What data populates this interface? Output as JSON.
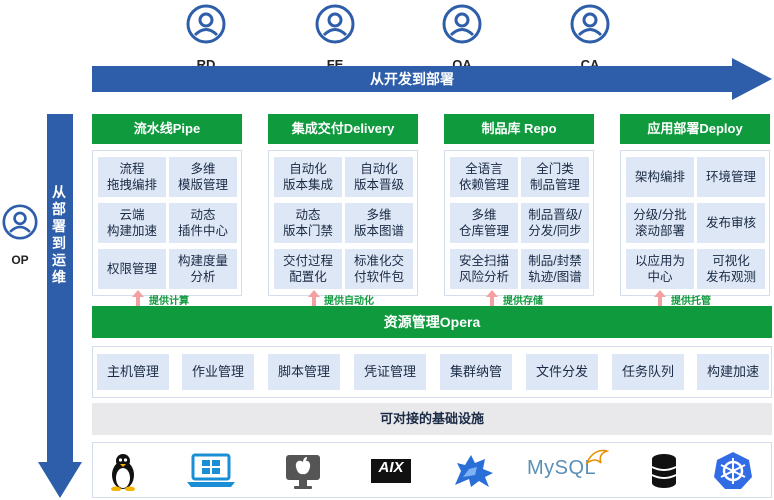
{
  "roles": [
    "RD",
    "FE",
    "QA",
    "CA"
  ],
  "op_role": "OP",
  "top_arrow_label": "从开发到部署",
  "side_arrow_label": [
    "从",
    "部",
    "署",
    "到",
    "运",
    "维"
  ],
  "panels": [
    {
      "title": "流水线Pipe",
      "items": [
        "流程\n拖拽编排",
        "多维\n模版管理",
        "云端\n构建加速",
        "动态\n插件中心",
        "权限管理",
        "构建度量\n分析"
      ],
      "provides": "提供计算"
    },
    {
      "title": "集成交付Delivery",
      "items": [
        "自动化\n版本集成",
        "自动化\n版本晋级",
        "动态\n版本门禁",
        "多维\n版本图谱",
        "交付过程\n配置化",
        "标准化交\n付软件包"
      ],
      "provides": "提供自动化"
    },
    {
      "title": "制品库 Repo",
      "items": [
        "全语言\n依赖管理",
        "全门类\n制品管理",
        "多维\n仓库管理",
        "制品晋级/\n分发/同步",
        "安全扫描\n风险分析",
        "制品/封禁\n轨迹/图谱"
      ],
      "provides": "提供存储"
    },
    {
      "title": "应用部署Deploy",
      "items": [
        "架构编排",
        "环境管理",
        "分级/分批\n滚动部署",
        "发布审核",
        "以应用为\n中心",
        "可视化\n发布观测"
      ],
      "provides": "提供托管"
    }
  ],
  "opera": {
    "title": "资源管理Opera"
  },
  "ops_items": [
    "主机管理",
    "作业管理",
    "脚本管理",
    "凭证管理",
    "集群纳管",
    "文件分发",
    "任务队列",
    "构建加速"
  ],
  "infra": {
    "title": "可对接的基础设施"
  },
  "infra_logos": {
    "linux": "linux-penguin-icon",
    "windows": "windows-laptop-icon",
    "mac": "apple-mac-icon",
    "aix": "AIX",
    "kylin": "kylin-icon",
    "mysql": "MySQL",
    "database": "database-icon",
    "kubernetes": "kubernetes-helm-icon"
  },
  "colors": {
    "green": "#0f9a3e",
    "blue": "#2e5ea9",
    "cell": "#dde7f5",
    "arrow_up": "#f5a0a0"
  }
}
